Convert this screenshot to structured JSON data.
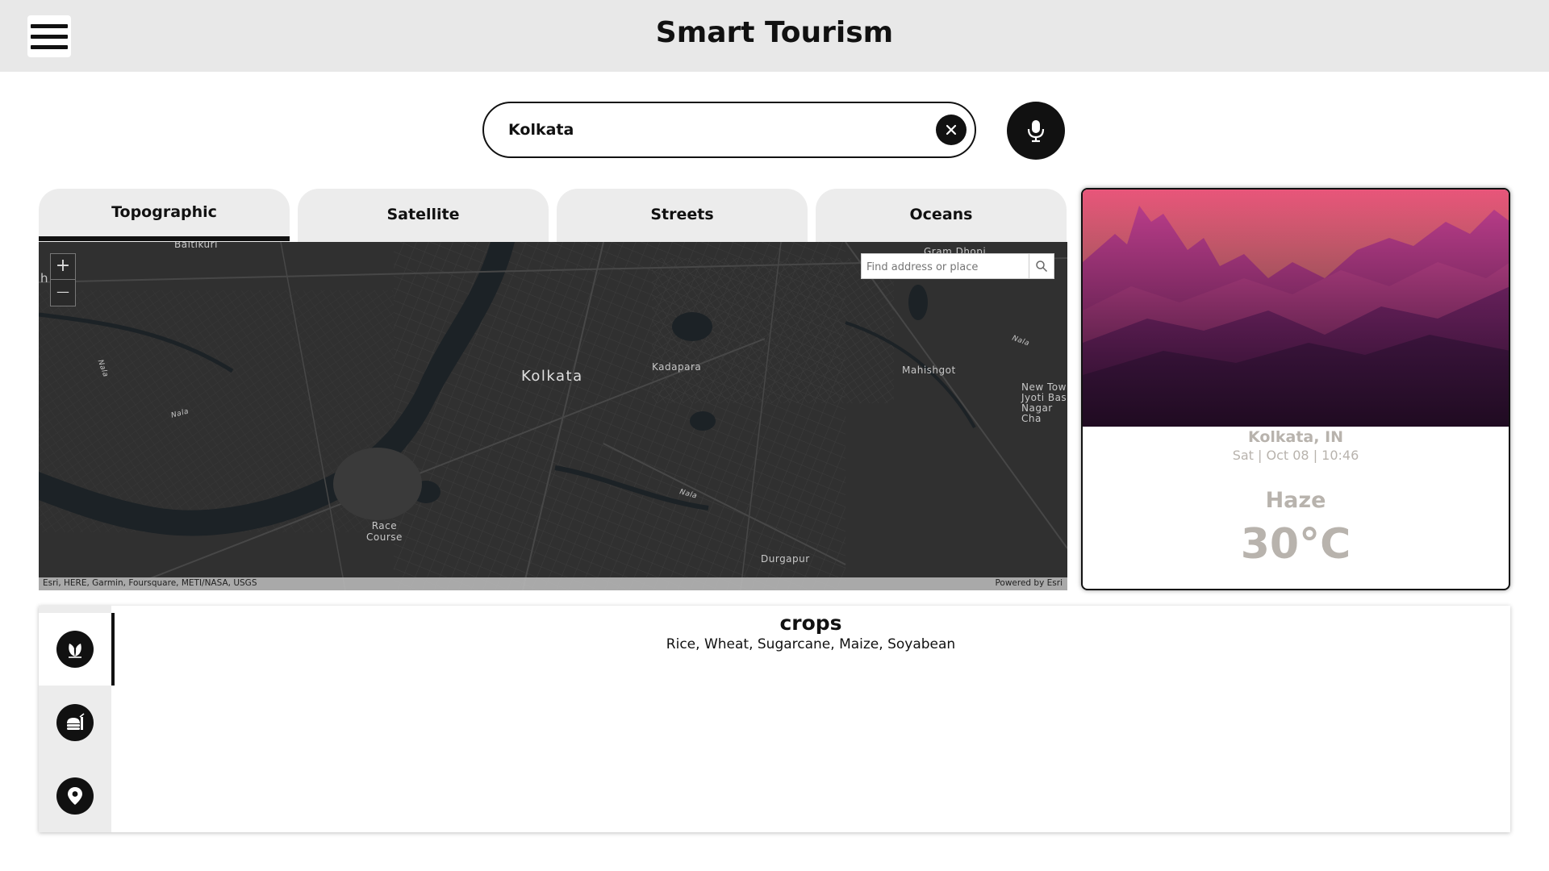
{
  "header": {
    "title": "Smart Tourism"
  },
  "search": {
    "value": "Kolkata"
  },
  "map": {
    "tabs": [
      {
        "label": "Topographic",
        "active": true
      },
      {
        "label": "Satellite",
        "active": false
      },
      {
        "label": "Streets",
        "active": false
      },
      {
        "label": "Oceans",
        "active": false
      }
    ],
    "zoom_in": "+",
    "zoom_out": "—",
    "search_placeholder": "Find address or place",
    "labels": {
      "city": "Kolkata",
      "kadapara": "Kadapara",
      "mahishgot": "Mahishgot",
      "new_town": "New Tow\nJyoti Bas\nNagar\nCha",
      "race_course": "Race\nCourse",
      "durgapur": "Durgapur",
      "gram_dhopi": "Gram Dhopi",
      "baltikuri": "Baltikuri",
      "nala1": "Nala",
      "nala2": "Nala",
      "nala3": "Nala",
      "nala4": "Nala",
      "edge": "h"
    },
    "attribution": "Esri, HERE, Garmin, Foursquare, METI/NASA, USGS",
    "powered_by": "Powered by Esri"
  },
  "weather": {
    "location": "Kolkata, IN",
    "datetime": "Sat | Oct 08 | 10:46",
    "condition": "Haze",
    "temperature": "30°C"
  },
  "info": {
    "title": "crops",
    "text": "Rice, Wheat, Sugarcane, Maize, Soyabean",
    "icons": [
      "leaf-icon",
      "food-icon",
      "location-pin-icon"
    ]
  },
  "colors": {
    "accent": "#111111",
    "header_bg": "#e8e8e8",
    "map_bg": "#333333",
    "weather_text": "#b8b3ad"
  }
}
